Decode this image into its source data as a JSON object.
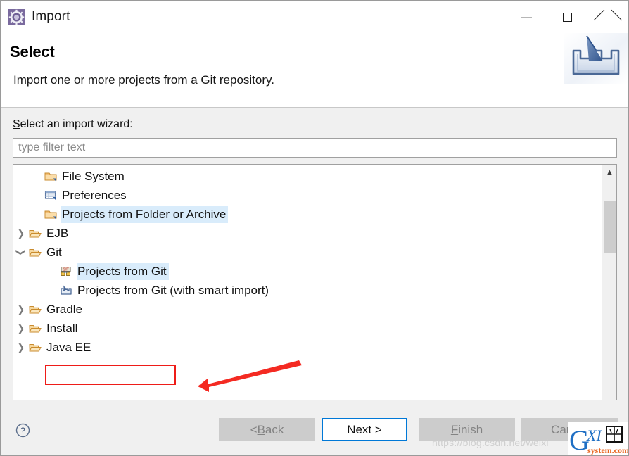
{
  "window": {
    "title": "Import",
    "icon": "import-wizard-icon",
    "controls": {
      "minimize": "minimize-button",
      "maximize": "maximize-button",
      "close": "close-button"
    }
  },
  "header": {
    "title": "Select",
    "description": "Import one or more projects from a Git repository.",
    "banner_icon": "import-tray-icon"
  },
  "form": {
    "label_prefix": "S",
    "label_rest": "elect an import wizard:",
    "filter_placeholder": "type filter text",
    "filter_value": ""
  },
  "tree": {
    "items": [
      {
        "label": "File System",
        "depth": 1,
        "twisty": "",
        "icon": "folder-icon",
        "selected": false
      },
      {
        "label": "Preferences",
        "depth": 1,
        "twisty": "",
        "icon": "preferences-icon",
        "selected": false
      },
      {
        "label": "Projects from Folder or Archive",
        "depth": 1,
        "twisty": "",
        "icon": "folder-icon",
        "selected": true
      },
      {
        "label": "EJB",
        "depth": 0,
        "twisty": "collapsed",
        "icon": "open-folder-icon",
        "selected": false
      },
      {
        "label": "Git",
        "depth": 0,
        "twisty": "expanded",
        "icon": "open-folder-icon",
        "selected": false
      },
      {
        "label": "Projects from Git",
        "depth": 1,
        "twisty": "",
        "icon": "git-icon",
        "selected": true
      },
      {
        "label": "Projects from Git (with smart import)",
        "depth": 1,
        "twisty": "",
        "icon": "smart-import-icon",
        "selected": false
      },
      {
        "label": "Gradle",
        "depth": 0,
        "twisty": "collapsed",
        "icon": "open-folder-icon",
        "selected": false
      },
      {
        "label": "Install",
        "depth": 0,
        "twisty": "collapsed",
        "icon": "open-folder-icon",
        "selected": false
      },
      {
        "label": "Java EE",
        "depth": 0,
        "twisty": "collapsed",
        "icon": "open-folder-icon",
        "selected": false
      }
    ],
    "scroll": {
      "up_arrow": "⌃",
      "down_arrow": "⌄"
    }
  },
  "footer": {
    "help": "help-icon",
    "back": {
      "prefix": "< ",
      "mnemonic": "B",
      "rest": "ack",
      "enabled": false
    },
    "next": {
      "prefix": "",
      "mnemonic": "N",
      "rest": "ext >",
      "enabled": true,
      "focused": true
    },
    "finish": {
      "prefix": "",
      "mnemonic": "F",
      "rest": "inish",
      "enabled": false
    },
    "cancel": {
      "prefix": "",
      "mnemonic": "C",
      "rest": "ancel",
      "enabled": true
    }
  },
  "annotations": {
    "highlight_target": "Projects from Git",
    "arrow_color": "#ee1c18",
    "rect_color": "#ee1c18"
  },
  "watermark": {
    "url_text": "https://blog.csdn.net/weixi",
    "logo_g": "G",
    "logo_xi": "XI",
    "logo_cjk": "网",
    "logo_sub": "system.com"
  },
  "colors": {
    "accent": "#0078d7",
    "selection": "#d9ecfb",
    "folder": "#f0b04a",
    "annotation": "#ee1c18",
    "dialog_bg": "#f0f0f0"
  }
}
